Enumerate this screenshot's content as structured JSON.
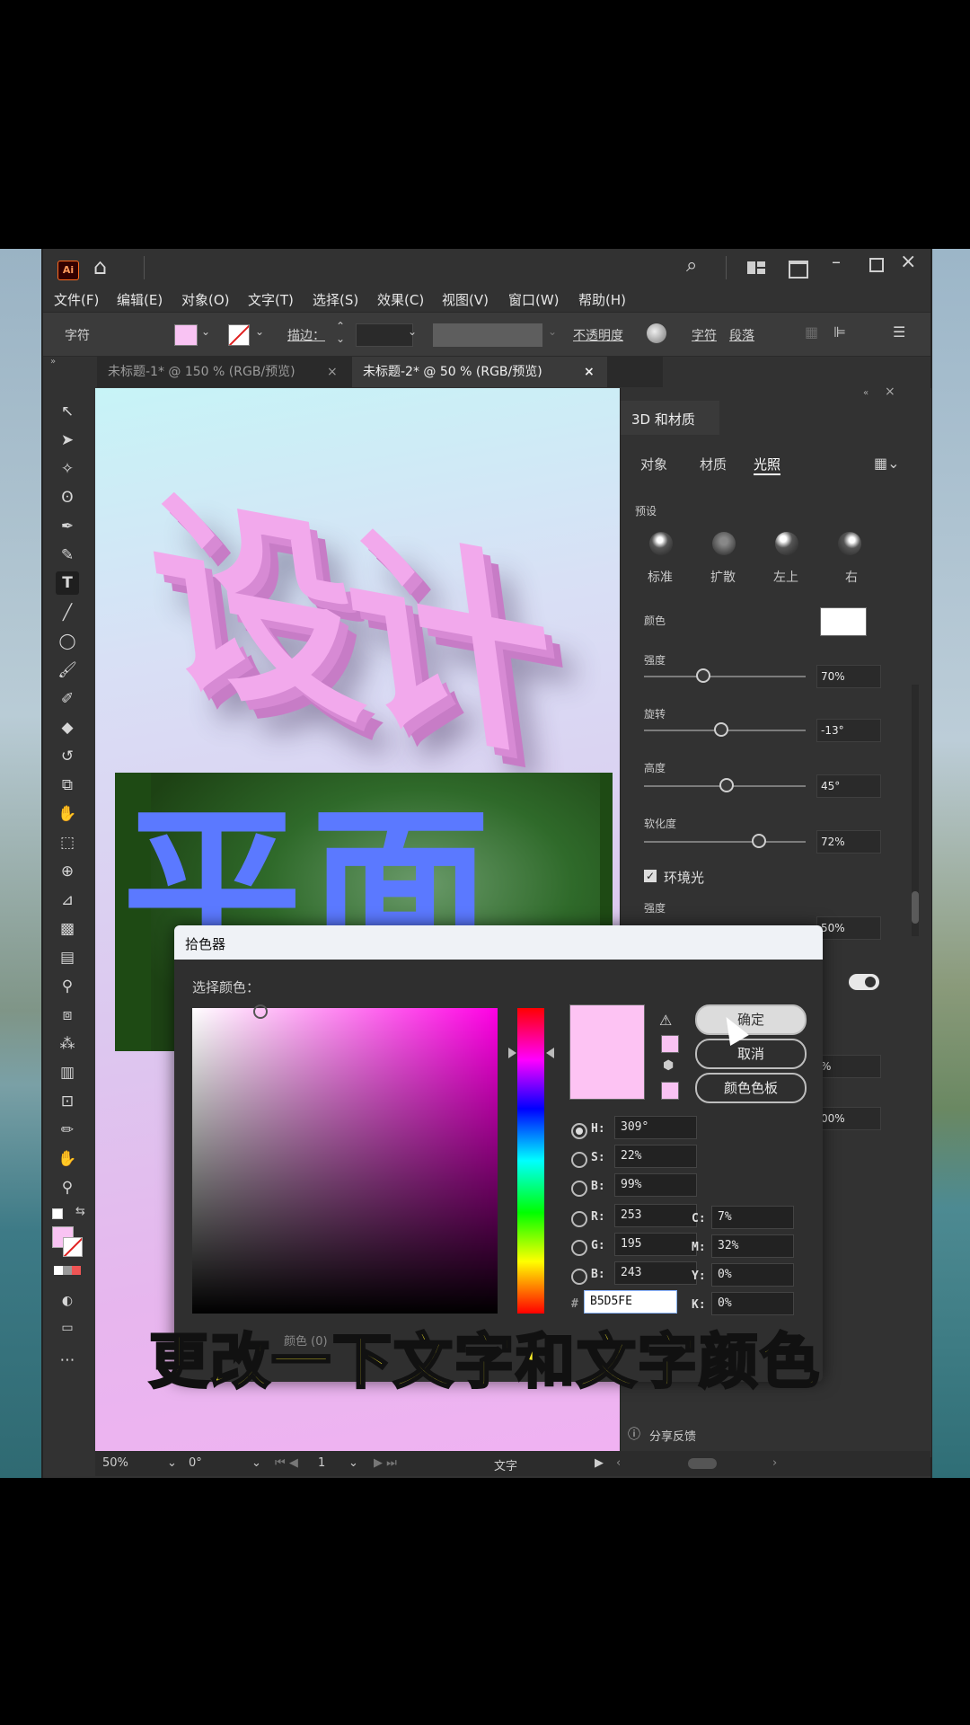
{
  "app": {
    "logo": "Ai",
    "home_icon": "home-icon",
    "colors": {
      "accent_pink": "#F9C3F3",
      "hex_value": "#B5D5FE",
      "subtitle": "#FFF12A"
    }
  },
  "menus": [
    "文件(F)",
    "编辑(E)",
    "对象(O)",
    "文字(T)",
    "选择(S)",
    "效果(C)",
    "视图(V)",
    "窗口(W)",
    "帮助(H)"
  ],
  "control_bar": {
    "label": "字符",
    "stroke_label": "描边：",
    "opacity_label": "不透明度",
    "char_label": "字符",
    "para_label": "段落"
  },
  "tabs": [
    {
      "label": "未标题-1* @ 150 % (RGB/预览)",
      "close": "×"
    },
    {
      "label": "未标题-2* @ 50 % (RGB/预览)",
      "close": "×"
    }
  ],
  "artwork": {
    "top_text": "设计",
    "bottom_text": "平面"
  },
  "panel": {
    "title": "3D 和材质",
    "tabs": [
      "对象",
      "材质",
      "光照"
    ],
    "preset_label": "预设",
    "presets": [
      "标准",
      "扩散",
      "左上",
      "右"
    ],
    "color_label": "颜色",
    "intensity_label": "强度",
    "intensity_value": "70%",
    "rotation_label": "旋转",
    "rotation_value": "-13°",
    "height_label": "高度",
    "height_value": "45°",
    "softness_label": "软化度",
    "softness_value": "72%",
    "ambient_label": "环境光",
    "ambient_intensity_label": "强度",
    "ambient_intensity_value": "50%",
    "partial_value_1": "%",
    "partial_value_2": "00%",
    "feedback_label": "分享反馈"
  },
  "color_picker": {
    "title": "拾色器",
    "select_label": "选择颜色：",
    "ok_label": "确定",
    "cancel_label": "取消",
    "swatches_label": "颜色色板",
    "hsb": [
      {
        "label": "H:",
        "value": "309°"
      },
      {
        "label": "S:",
        "value": "22%"
      },
      {
        "label": "B:",
        "value": "99%"
      }
    ],
    "rgb": [
      {
        "label": "R:",
        "value": "253"
      },
      {
        "label": "G:",
        "value": "195"
      },
      {
        "label": "B:",
        "value": "243"
      }
    ],
    "cmyk": [
      {
        "label": "C:",
        "value": "7%"
      },
      {
        "label": "M:",
        "value": "32%"
      },
      {
        "label": "Y:",
        "value": "0%"
      },
      {
        "label": "K:",
        "value": "0%"
      }
    ],
    "hex_prefix": "#",
    "hex_value": "B5D5FE",
    "partial_label": "颜色 (0)"
  },
  "status_bar": {
    "zoom": "50%",
    "rotation": "0°",
    "artboard": "1",
    "tool": "文字"
  },
  "subtitle": "更改一下文字和文字颜色"
}
